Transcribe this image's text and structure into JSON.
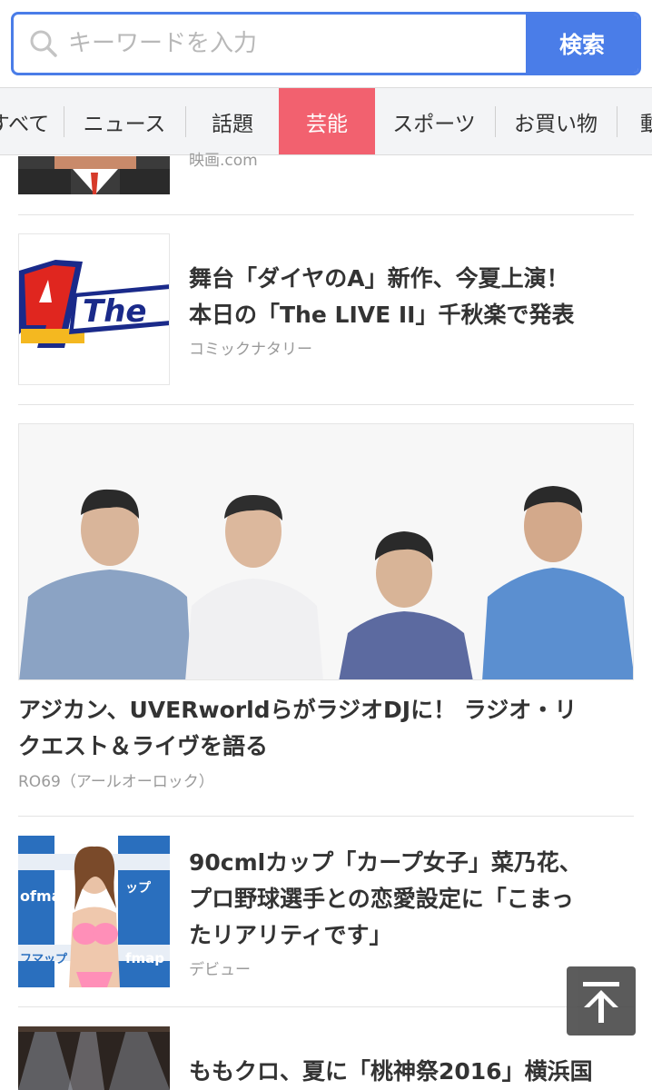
{
  "search": {
    "placeholder": "キーワードを入力",
    "button_label": "検索"
  },
  "tabs": [
    {
      "label": "すべて",
      "active": false
    },
    {
      "label": "ニュース",
      "active": false
    },
    {
      "label": "話題",
      "active": false
    },
    {
      "label": "芸能",
      "active": true
    },
    {
      "label": "スポーツ",
      "active": false
    },
    {
      "label": "お買い物",
      "active": false
    },
    {
      "label": "動",
      "active": false
    }
  ],
  "articles": [
    {
      "source": "映画.com"
    },
    {
      "title_line1": "舞台「ダイヤのA」新作、今夏上演！",
      "title_line2": "本日の「The LIVE II」千秋楽で発表",
      "source": "コミックナタリー",
      "thumb_text": "The"
    },
    {
      "title_line1": "アジカン、UVERworldらがラジオDJに！ ラジオ・リ",
      "title_line2": "クエスト＆ライヴを語る",
      "source": "RO69（アールオーロック）"
    },
    {
      "title_line1": "90cmlカップ「カープ女子」菜乃花、",
      "title_line2": "プロ野球選手との恋愛設定に「こまっ",
      "title_line3": "たリアリティです」",
      "source": "デビュー",
      "thumb_text1": "ofmap",
      "thumb_text2": "ップ",
      "thumb_text3": "フマップ",
      "thumb_text4": "fmap"
    },
    {
      "title_line1": "ももクロ、夏に「桃神祭2016」横浜国"
    }
  ],
  "colors": {
    "accent": "#4a7de8",
    "active_tab": "#f2616f",
    "tab_bar": "#f3f4f6"
  },
  "icons": {
    "search": "search-icon",
    "to_top": "arrow-up-icon"
  }
}
